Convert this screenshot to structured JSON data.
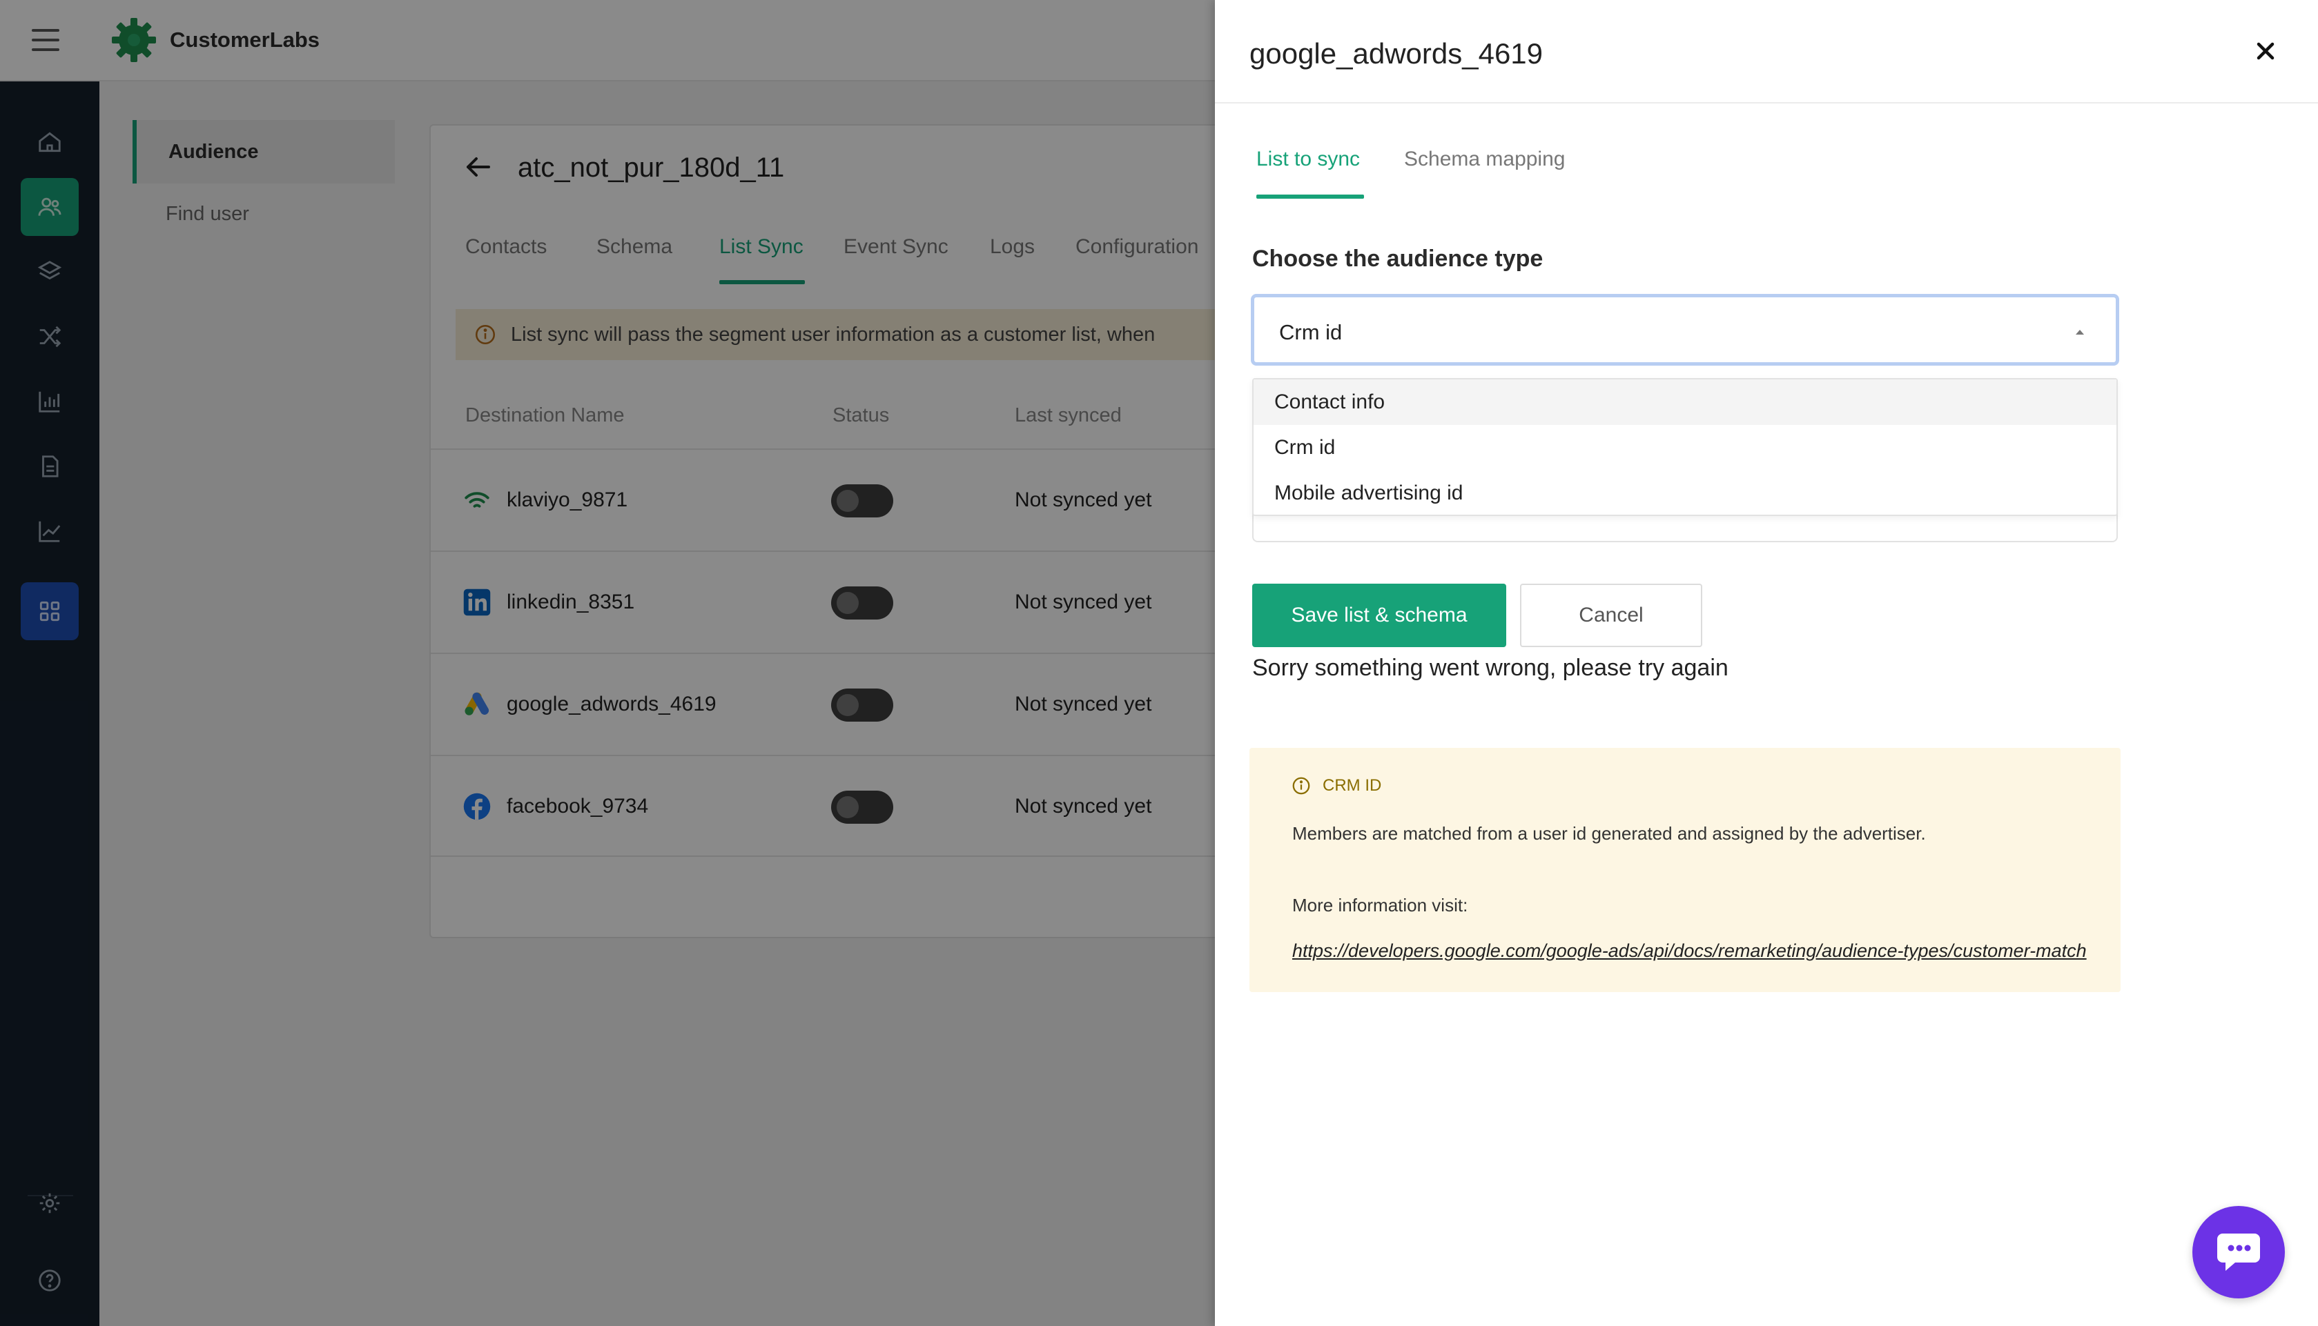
{
  "app": {
    "brand": "CustomerLabs"
  },
  "rail": {
    "icons": [
      "home-icon",
      "audience-icon",
      "layers-icon",
      "shuffle-icon",
      "bar-chart-icon",
      "document-icon",
      "trend-icon",
      "apps-icon",
      "settings-icon",
      "help-icon"
    ],
    "active": "audience-icon"
  },
  "subnav": {
    "audience": "Audience",
    "find_user": "Find user"
  },
  "segment": {
    "title": "atc_not_pur_180d_11",
    "tabs": [
      "Contacts",
      "Schema",
      "List Sync",
      "Event Sync",
      "Logs",
      "Configuration"
    ],
    "active_tab": "List Sync",
    "notice": "List sync will pass the segment user information as a customer list, when",
    "columns": {
      "name": "Destination Name",
      "status": "Status",
      "last_synced": "Last synced"
    },
    "rows": [
      {
        "name": "klaviyo_9871",
        "status": "Not synced yet",
        "icon": "klaviyo-icon"
      },
      {
        "name": "linkedin_8351",
        "status": "Not synced yet",
        "icon": "linkedin-icon"
      },
      {
        "name": "google_adwords_4619",
        "status": "Not synced yet",
        "icon": "google-ads-icon"
      },
      {
        "name": "facebook_9734",
        "status": "Not synced yet",
        "icon": "facebook-icon"
      }
    ]
  },
  "drawer": {
    "title": "google_adwords_4619",
    "tabs": [
      "List to sync",
      "Schema mapping"
    ],
    "active_tab": "List to sync",
    "audience_label": "Choose the audience type",
    "select_value": "Crm id",
    "options": [
      "Contact info",
      "Crm id",
      "Mobile advertising id"
    ],
    "save_label": "Save list & schema",
    "cancel_label": "Cancel",
    "error": "Sorry something went wrong, please try again",
    "info": {
      "title": "CRM ID",
      "description": "Members are matched from a user id generated and assigned by the advertiser.",
      "more": "More information visit:",
      "link": "https://developers.google.com/google-ads/api/docs/remarketing/audience-types/customer-match"
    }
  },
  "colors": {
    "accent": "#17a278",
    "rail": "#15202c",
    "apps": "#1f4fb3",
    "chat": "#6c32e6"
  }
}
